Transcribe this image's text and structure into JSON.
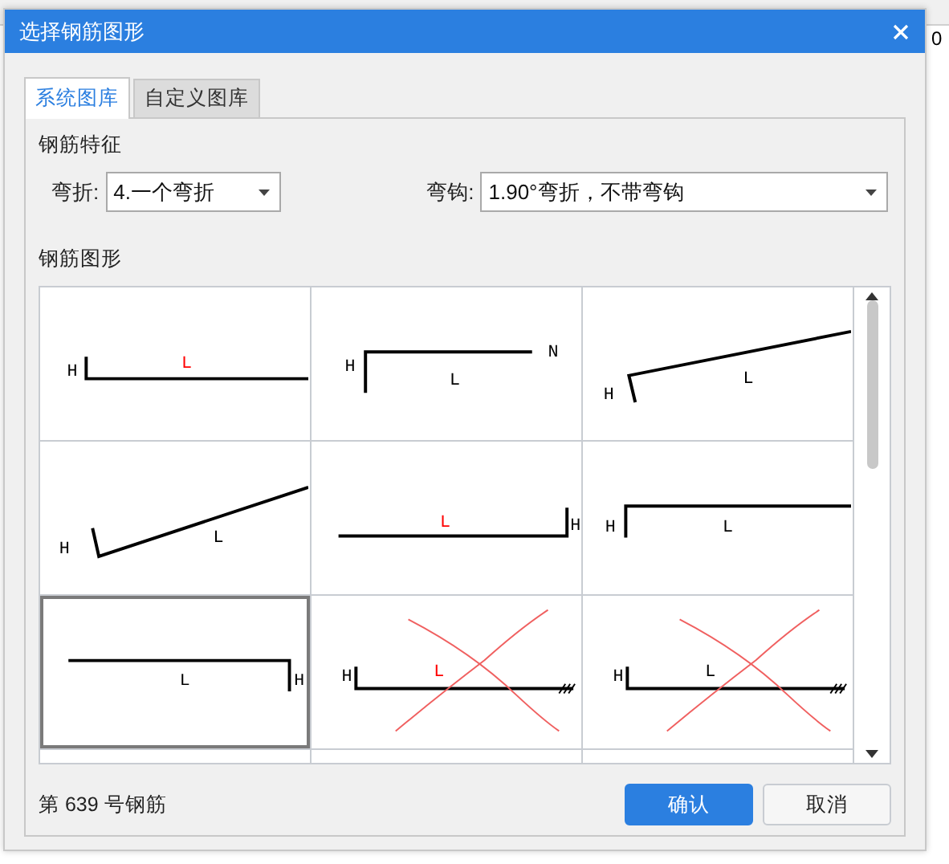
{
  "background": {
    "cell": "0"
  },
  "window": {
    "title": "选择钢筋图形"
  },
  "tabs": [
    {
      "label": "系统图库",
      "selected": true
    },
    {
      "label": "自定义图库",
      "selected": false
    }
  ],
  "features": {
    "title": "钢筋特征",
    "fields": [
      {
        "label": "弯折:",
        "value": "4.一个弯折",
        "kind": "short"
      },
      {
        "label": "弯钩:",
        "value": "1.90°弯折，不带弯钩",
        "kind": "wide"
      }
    ]
  },
  "shapes": {
    "title": "钢筋图形",
    "cells": [
      {
        "kind": "flat",
        "selected": false,
        "crossed": false,
        "labels": [
          {
            "text": "H",
            "color": "#000000"
          },
          {
            "text": "L",
            "color": "#ff0000"
          }
        ]
      },
      {
        "kind": "angle",
        "selected": false,
        "crossed": false,
        "labels": [
          {
            "text": "H",
            "color": "#000000"
          },
          {
            "text": "L",
            "color": "#000000"
          },
          {
            "text": "N",
            "color": "#000000"
          }
        ]
      },
      {
        "kind": "slope",
        "selected": false,
        "crossed": false,
        "labels": [
          {
            "text": "H",
            "color": "#000000"
          },
          {
            "text": "L",
            "color": "#000000"
          }
        ]
      },
      {
        "kind": "incline",
        "selected": false,
        "crossed": false,
        "labels": [
          {
            "text": "H",
            "color": "#000000"
          },
          {
            "text": "L",
            "color": "#000000"
          }
        ]
      },
      {
        "kind": "endhook",
        "selected": false,
        "crossed": false,
        "labels": [
          {
            "text": "L",
            "color": "#ff0000"
          },
          {
            "text": "H",
            "color": "#000000"
          }
        ]
      },
      {
        "kind": "step",
        "selected": false,
        "crossed": false,
        "labels": [
          {
            "text": "H",
            "color": "#000000"
          },
          {
            "text": "L",
            "color": "#000000"
          }
        ]
      },
      {
        "kind": "bracket",
        "selected": true,
        "crossed": false,
        "labels": [
          {
            "text": "L",
            "color": "#000000"
          },
          {
            "text": "H",
            "color": "#000000"
          }
        ]
      },
      {
        "kind": "hatched",
        "selected": false,
        "crossed": true,
        "labels": [
          {
            "text": "H",
            "color": "#000000"
          },
          {
            "text": "L",
            "color": "#ff0000"
          }
        ]
      },
      {
        "kind": "hatched",
        "selected": false,
        "crossed": true,
        "labels": [
          {
            "text": "H",
            "color": "#000000"
          },
          {
            "text": "L",
            "color": "#000000"
          }
        ]
      }
    ]
  },
  "status": "第 639 号钢筋",
  "buttons": [
    {
      "label": "确认",
      "kind": "primary"
    },
    {
      "label": "取消",
      "kind": "secondary"
    }
  ]
}
